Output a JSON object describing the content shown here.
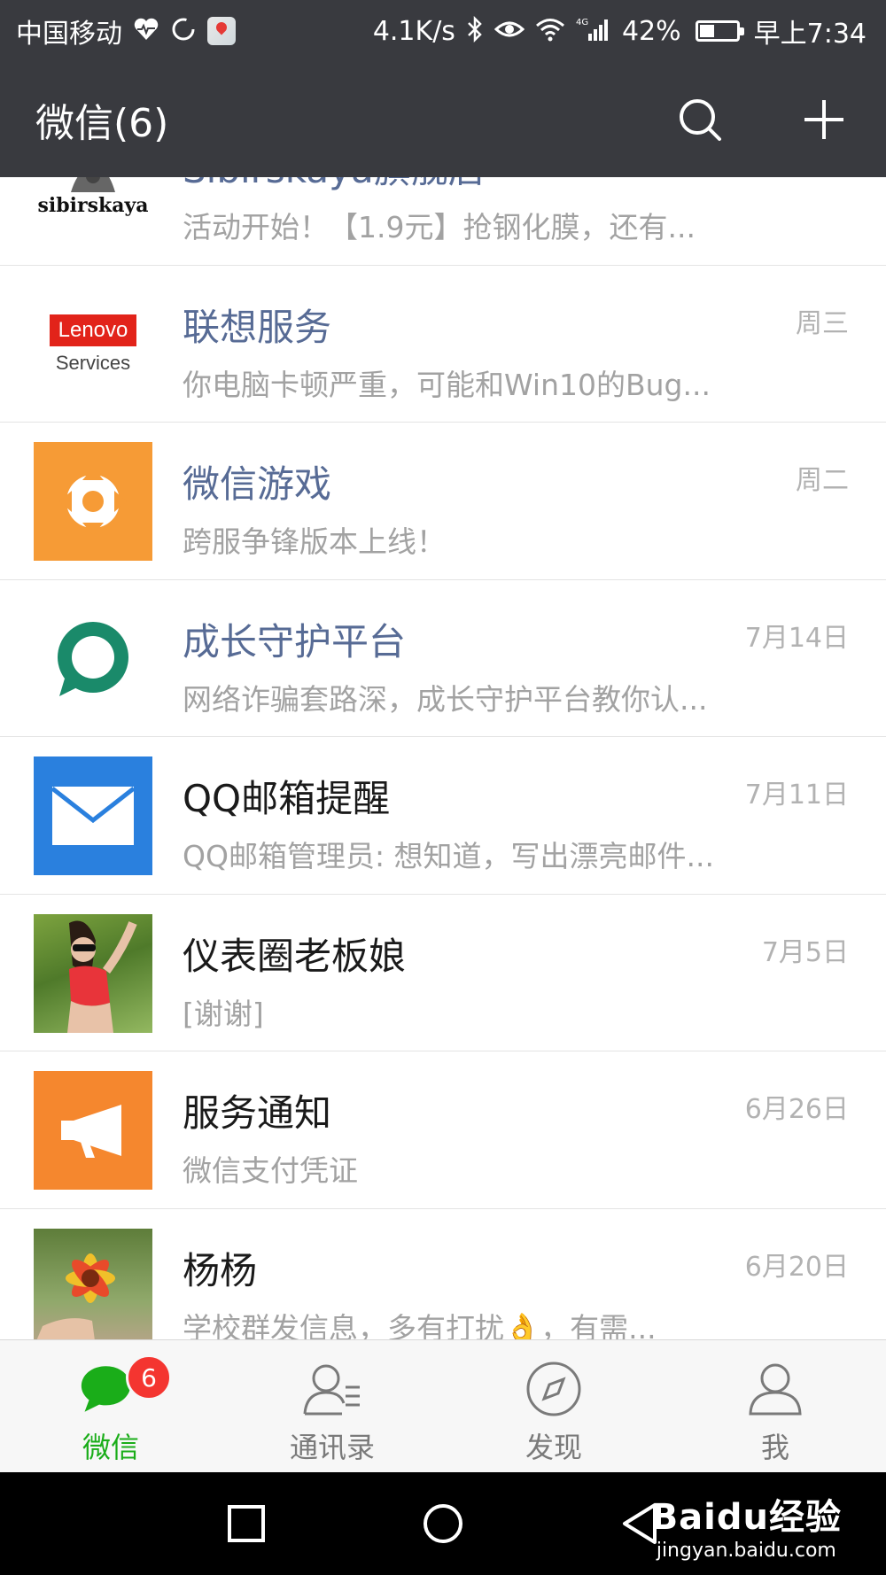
{
  "status_bar": {
    "carrier": "中国移动",
    "network_speed": "4.1K/s",
    "network_type": "4G",
    "battery": "42%",
    "battery_level": 0.42,
    "time": "早上7:34"
  },
  "header": {
    "title": "微信(6)",
    "search_icon": "search-icon",
    "add_icon": "plus-icon"
  },
  "chats": [
    {
      "name": "Sibirskaya旗舰店",
      "time": "",
      "preview": "活动开始！【1.9元】抢钢化膜，还有...",
      "official": true,
      "avatar_text": "sibirskaya"
    },
    {
      "name": "联想服务",
      "time": "周三",
      "preview": "你电脑卡顿严重，可能和Win10的Bug...",
      "official": true,
      "avatar_text": "Lenovo",
      "avatar_subtext": "Services"
    },
    {
      "name": "微信游戏",
      "time": "周二",
      "preview": "跨服争锋版本上线！",
      "official": true
    },
    {
      "name": "成长守护平台",
      "time": "7月14日",
      "preview": "网络诈骗套路深，成长守护平台教你认...",
      "official": true
    },
    {
      "name": "QQ邮箱提醒",
      "time": "7月11日",
      "preview": "QQ邮箱管理员: 想知道，写出漂亮邮件...",
      "official": false
    },
    {
      "name": "仪表圈老板娘",
      "time": "7月5日",
      "preview": "[谢谢]",
      "official": false
    },
    {
      "name": "服务通知",
      "time": "6月26日",
      "preview": "微信支付凭证",
      "official": false
    },
    {
      "name": "杨杨",
      "time": "6月20日",
      "preview": "学校群发信息，多有打扰👌，有需...",
      "official": false
    }
  ],
  "tabs": [
    {
      "label": "微信",
      "icon": "chat-bubbles-icon",
      "badge": "6",
      "active": true
    },
    {
      "label": "通讯录",
      "icon": "contacts-icon",
      "active": false
    },
    {
      "label": "发现",
      "icon": "compass-icon",
      "active": false
    },
    {
      "label": "我",
      "icon": "person-icon",
      "active": false
    }
  ],
  "watermark": {
    "logo": "Baidu经验",
    "url": "jingyan.baidu.com"
  },
  "colors": {
    "header_bg": "#393a3f",
    "official_name": "#576b95",
    "active_tab": "#1aad19",
    "badge": "#f43530"
  }
}
